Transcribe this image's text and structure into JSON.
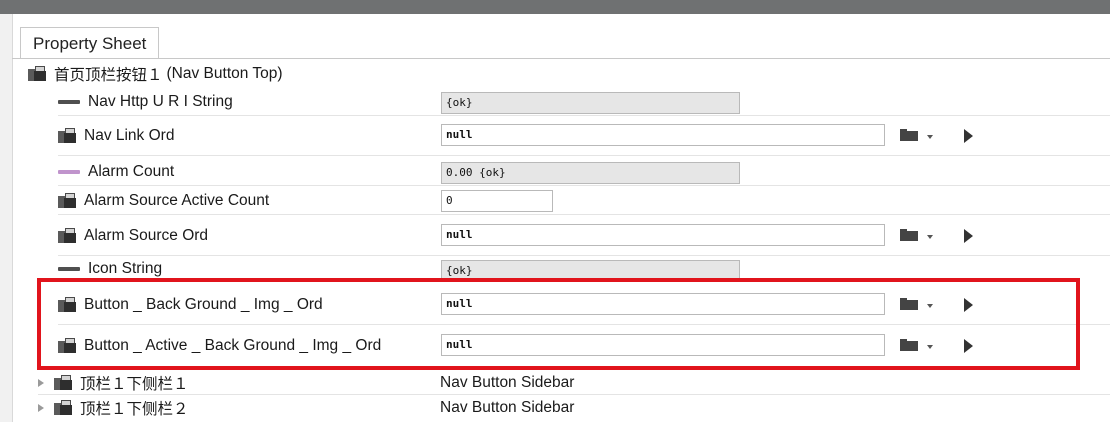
{
  "tab": {
    "label": "Property Sheet"
  },
  "root": {
    "label": "首页顶栏按钮１",
    "type": "(Nav Button Top)"
  },
  "rows": [
    {
      "label": "Nav Http U R I String",
      "value": "{ok}"
    },
    {
      "label": "Nav Link Ord",
      "value": "null"
    },
    {
      "label": "Alarm Count",
      "value": "0.00 {ok}"
    },
    {
      "label": "Alarm Source Active Count",
      "value": "0"
    },
    {
      "label": "Alarm Source Ord",
      "value": "null"
    },
    {
      "label": "Icon String",
      "value": "{ok}"
    },
    {
      "label": "Button _ Back Ground _ Img _ Ord",
      "value": "null"
    },
    {
      "label": "Button _ Active _ Back Ground _ Img _ Ord",
      "value": "null"
    }
  ],
  "children": [
    {
      "label": "顶栏１下侧栏１",
      "type": "Nav Button Sidebar"
    },
    {
      "label": "顶栏１下侧栏２",
      "type": "Nav Button Sidebar"
    }
  ],
  "colors": {
    "highlight": "#e1141c",
    "alarm_bar": "#c094cc",
    "readonly_bg": "#e6e6e6"
  },
  "icons": [
    "component-icon",
    "property-bar-icon",
    "folder-icon",
    "dropdown-caret-icon",
    "play-icon",
    "expand-triangle-icon",
    "double-arrow-icon"
  ]
}
